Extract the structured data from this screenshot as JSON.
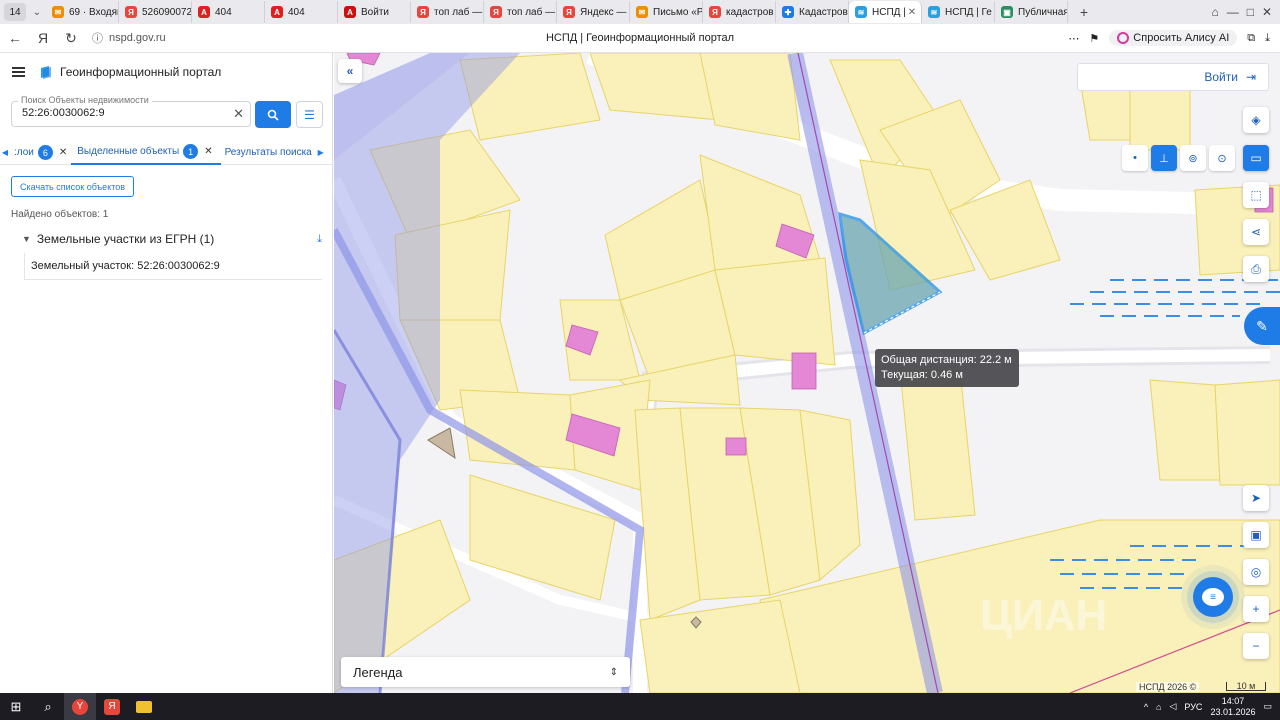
{
  "browser": {
    "tab_count": "14",
    "tabs": [
      {
        "label": "69 · Входящ",
        "color": "#f08c00",
        "glyph": "✉"
      },
      {
        "label": "526090072",
        "color": "#e8453c",
        "glyph": "Я"
      },
      {
        "label": "404",
        "color": "#e02020",
        "glyph": "A"
      },
      {
        "label": "404",
        "color": "#e02020",
        "glyph": "A"
      },
      {
        "label": "Войти",
        "color": "#d01010",
        "glyph": "A"
      },
      {
        "label": "топ лаб —",
        "color": "#e8453c",
        "glyph": "Я"
      },
      {
        "label": "топ лаб —",
        "color": "#e8453c",
        "glyph": "Я"
      },
      {
        "label": "Яндекс — б",
        "color": "#e8453c",
        "glyph": "Я"
      },
      {
        "label": "Письмо «Р",
        "color": "#f08c00",
        "glyph": "✉"
      },
      {
        "label": "кадастров",
        "color": "#e8453c",
        "glyph": "Я"
      },
      {
        "label": "Кадастров",
        "color": "#1f7be6",
        "glyph": "✚"
      },
      {
        "label": "НСПД | ",
        "color": "#2aa0e0",
        "glyph": "≋"
      },
      {
        "label": "НСПД | Ге",
        "color": "#2aa0e0",
        "glyph": "≋"
      },
      {
        "label": "Публичная",
        "color": "#2a8f60",
        "glyph": "▣"
      }
    ],
    "active_tab_index": 11,
    "url": "nspd.gov.ru",
    "page_title": "НСПД | Геоинформационный портал",
    "alice_label": "Спросить Алису AI"
  },
  "panel": {
    "title": "Геоинформационный портал",
    "search_label": "Поиск Объекты недвижимости",
    "search_value": "52:26:0030062:9",
    "tabs": [
      {
        "label": ":лои",
        "count": "6"
      },
      {
        "label": "Выделенные объекты",
        "count": "1"
      },
      {
        "label": "Результаты поиска"
      }
    ],
    "download_list": "Скачать список объектов",
    "found_text": "Найдено объектов: 1",
    "group_label": "Земельные участки из ЕГРН (1)",
    "item_label": "Земельный участок: 52:26:0030062:9"
  },
  "map": {
    "login_label": "Войти",
    "tooltip_line1": "Общая дистанция: 22.2 м",
    "tooltip_line2": "Текущая: 0.46 м",
    "legend_label": "Легенда",
    "copyright": "НСПД 2026 ©",
    "scale_label": "10 м",
    "watermark": "ЦИАН",
    "colors": {
      "parcel_fill": "#faf0b9",
      "parcel_stroke": "#e8d466",
      "building": "#e487d4",
      "road_band": "#8f96e8",
      "selected_stroke": "#1f8fe6",
      "selected_fill": "#6aa6b0"
    }
  },
  "taskbar": {
    "lang": "РУС",
    "time": "14:07",
    "date": "23.01.2026"
  }
}
